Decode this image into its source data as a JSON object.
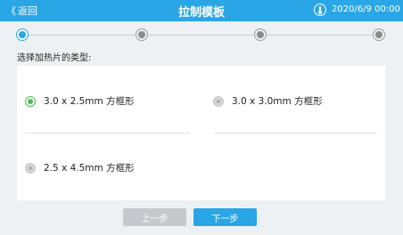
{
  "header": {
    "back_label": "返回",
    "back_glyph": "《",
    "title": "拉制模板",
    "datetime": "2020/6/9  00:00",
    "temp_icon": "thermometer-icon"
  },
  "stepper": {
    "total": 4,
    "current": 1
  },
  "prompt": "选择加热片的类型:",
  "options": [
    {
      "label": "3.0 x 2.5mm 方框形",
      "selected": true
    },
    {
      "label": "3.0 x 3.0mm 方框形",
      "selected": false
    },
    {
      "label": "2.5 x 4.5mm 方框形",
      "selected": false
    }
  ],
  "buttons": {
    "prev": "上一步",
    "next": "下一步"
  },
  "colors": {
    "accent": "#2aa6e6",
    "selected": "#4cbf57",
    "disabled": "#c5c8cc"
  }
}
